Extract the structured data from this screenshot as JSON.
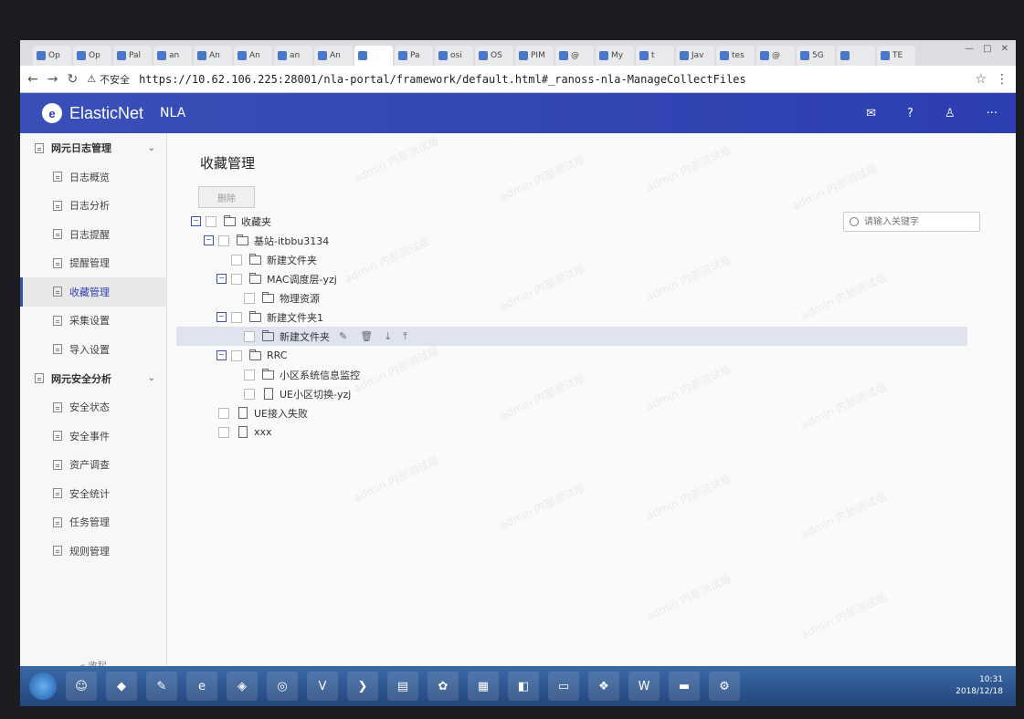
{
  "browser": {
    "tabs": [
      "Op",
      "Op",
      "Pal",
      "an",
      "An",
      "An",
      "an",
      "An",
      "",
      "Pa",
      "osi",
      "OS",
      "PIM",
      "@",
      "My",
      "t",
      "Jav",
      "tes",
      "@",
      "5G",
      "",
      "TE"
    ],
    "security_label": "不安全",
    "url": "https://10.62.106.225:28001/nla-portal/framework/default.html#_ranoss-nla-ManageCollectFiles"
  },
  "app": {
    "brand": "ElasticNet",
    "product": "NLA"
  },
  "sidebar": {
    "groups": [
      {
        "label": "网元日志管理",
        "items": [
          "日志概览",
          "日志分析",
          "日志提醒",
          "提醒管理",
          "收藏管理",
          "采集设置",
          "导入设置"
        ]
      },
      {
        "label": "网元安全分析",
        "items": [
          "安全状态",
          "安全事件",
          "资产调查",
          "安全统计",
          "任务管理",
          "规则管理"
        ]
      }
    ],
    "active_item": "收藏管理",
    "collapse_label": "« 收起"
  },
  "main": {
    "title": "收藏管理",
    "delete_label": "删除",
    "search_placeholder": "请输入关键字",
    "watermark": "admin 内部测试版",
    "tree": [
      {
        "label": "收藏夹",
        "level": 0,
        "type": "folder",
        "expanded": true
      },
      {
        "label": "基站-itbbu3134",
        "level": 1,
        "type": "folder",
        "expanded": true
      },
      {
        "label": "新建文件夹",
        "level": 2,
        "type": "folder"
      },
      {
        "label": "MAC调度层-yzj",
        "level": 2,
        "type": "folder",
        "expanded": true
      },
      {
        "label": "物理资源",
        "level": 3,
        "type": "folder"
      },
      {
        "label": "新建文件夹1",
        "level": 2,
        "type": "folder",
        "expanded": true
      },
      {
        "label": "新建文件夹",
        "level": 3,
        "type": "folder",
        "highlight": true
      },
      {
        "label": "RRC",
        "level": 2,
        "type": "folder",
        "expanded": true
      },
      {
        "label": "小区系统信息监控",
        "level": 3,
        "type": "folder"
      },
      {
        "label": "UE小区切换-yzj",
        "level": 3,
        "type": "file"
      },
      {
        "label": "UE接入失败",
        "level": 1,
        "type": "file"
      },
      {
        "label": "xxx",
        "level": 1,
        "type": "file"
      }
    ]
  },
  "taskbar": {
    "time": "10:31",
    "date": "2018/12/18"
  },
  "colors": {
    "brand_blue": "#2d3fb0",
    "highlight_row": "#dfe3f0"
  }
}
